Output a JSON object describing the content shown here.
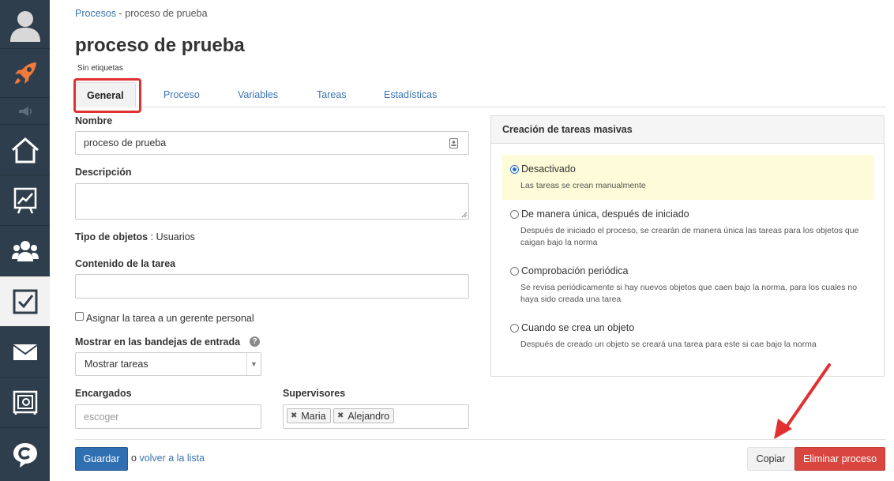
{
  "sidebar": {
    "items": [
      {
        "name": "avatar"
      },
      {
        "name": "rocket-icon"
      },
      {
        "name": "megaphone-icon"
      },
      {
        "name": "home-icon"
      },
      {
        "name": "chart-board-icon"
      },
      {
        "name": "users-icon"
      },
      {
        "name": "tasks-checkbox-icon",
        "active": true
      },
      {
        "name": "mail-icon"
      },
      {
        "name": "safe-icon"
      },
      {
        "name": "chat-icon"
      }
    ]
  },
  "breadcrumb": {
    "root": "Procesos",
    "separator": "-",
    "current": "proceso de prueba"
  },
  "header": {
    "title": "proceso de prueba",
    "tags": "Sin etiquetas"
  },
  "tabs": [
    {
      "label": "General",
      "active": true
    },
    {
      "label": "Proceso"
    },
    {
      "label": "Variables"
    },
    {
      "label": "Tareas"
    },
    {
      "label": "Estadísticas"
    }
  ],
  "form": {
    "name_label": "Nombre",
    "name_value": "proceso de prueba",
    "description_label": "Descripción",
    "description_value": "",
    "object_type_label": "Tipo de objetos",
    "object_type_value": ": Usuarios",
    "task_content_label": "Contenido de la tarea",
    "task_content_value": "",
    "assign_manager_label": "Asignar la tarea a un gerente personal",
    "assign_manager_checked": false,
    "inbox_label": "Mostrar en las bandejas de entrada",
    "inbox_value": "Mostrar tareas",
    "assignees_label": "Encargados",
    "assignees_placeholder": "escoger",
    "supervisors_label": "Supervisores",
    "supervisors": [
      "Maria",
      "Alejandro"
    ]
  },
  "bulk_panel": {
    "title": "Creación de tareas masivas",
    "options": [
      {
        "title": "Desactivado",
        "desc": "Las tareas se crean manualmente",
        "selected": true
      },
      {
        "title": "De manera única, después de iniciado",
        "desc": "Después de iniciado el proceso, se crearán de manera única las tareas para los objetos que caigan bajo la norma",
        "selected": false
      },
      {
        "title": "Comprobación periódica",
        "desc": "Se revisa periódicamente si hay nuevos objetos que caen bajo la norma, para los cuales no haya sido creada una tarea",
        "selected": false
      },
      {
        "title": "Cuando se crea un objeto",
        "desc": "Después de creado un objeto se creará una tarea para este si cae bajo la norma",
        "selected": false
      }
    ]
  },
  "footer": {
    "save_label": "Guardar",
    "or_label": "o",
    "back_label": "volver a la lista",
    "copy_label": "Copiar",
    "delete_label": "Eliminar proceso"
  },
  "colors": {
    "sidebar_bg": "#2f3e4c",
    "link": "#3b74b0",
    "primary": "#2f6fb2",
    "danger": "#d9453f",
    "highlight": "#e03030",
    "rocket": "#f07a3a"
  }
}
